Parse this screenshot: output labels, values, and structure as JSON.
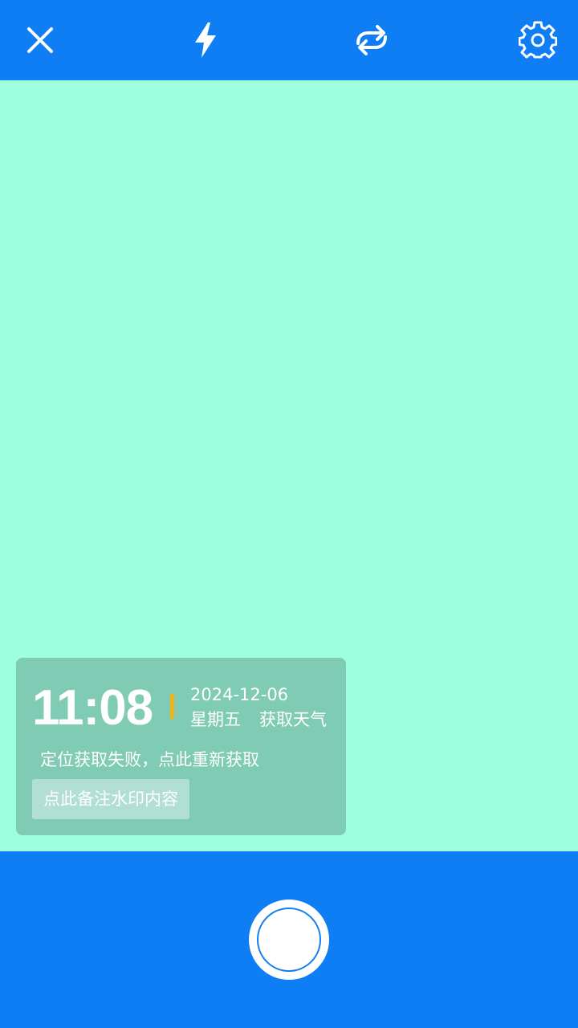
{
  "icons": {
    "close": "close-icon",
    "flash": "flash-icon",
    "switch_camera": "switch-camera-icon",
    "settings": "settings-icon"
  },
  "colors": {
    "bar": "#0f7ef5",
    "viewfinder": "#9effdf",
    "watermark_bg": "#7fcbb4",
    "divider": "#f0b41a"
  },
  "watermark": {
    "time": "11:08",
    "date": "2024-12-06",
    "weekday": "星期五",
    "weather_label": "获取天气",
    "location_text": "定位获取失败，点此重新获取",
    "note_placeholder": "点此备注水印内容"
  }
}
